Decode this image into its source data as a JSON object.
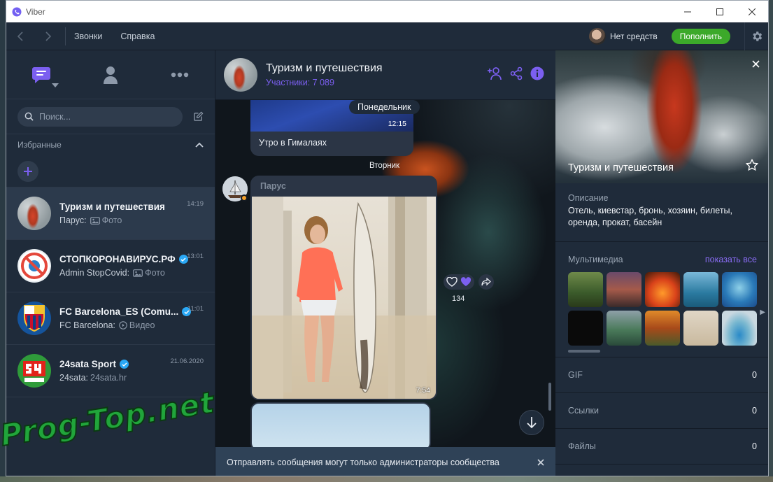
{
  "window": {
    "title": "Viber"
  },
  "topbar": {
    "menu": [
      "Звонки",
      "Справка"
    ],
    "account": "Нет средств",
    "topup": "Пополнить"
  },
  "search": {
    "placeholder": "Поиск..."
  },
  "favorites": {
    "label": "Избранные"
  },
  "chats": [
    {
      "name": "Туризм и путешествия",
      "sender": "Парус:",
      "preview": "Фото",
      "time": "14:19",
      "verified": false
    },
    {
      "name": "СТОПКОРОНАВИРУС.РФ",
      "sender": "Admin StopCovid:",
      "preview": "Фото",
      "time": "13:01",
      "verified": true
    },
    {
      "name": "FC Barcelona_ES (Comu...",
      "sender": "FC Barcelona:",
      "preview": "Видео",
      "time": "11:01",
      "verified": true
    },
    {
      "name": "24sata Sport",
      "sender": "24sata:",
      "preview": "24sata.hr",
      "time": "21.06.2020",
      "verified": true
    }
  ],
  "conversation": {
    "title": "Туризм и путешествия",
    "members": "Участники: 7 089",
    "messages": {
      "m1_time": "12:15",
      "m1_caption": "Утро в Гималаях",
      "day1": "Понедельник",
      "day2": "Вторник",
      "m2_sender": "Парус",
      "m2_time": "7:54",
      "reaction_count": "134"
    },
    "admin_notice": "Отправлять сообщения могут только администраторы сообщества"
  },
  "info": {
    "name": "Туризм и путешествия",
    "description_label": "Описание",
    "description": "Отель, киевстар, бронь, хозяин, билеты, оренда, прокат, басейн",
    "media_label": "Мультимедиа",
    "media_all": "показать все",
    "rows": [
      {
        "label": "GIF",
        "value": "0"
      },
      {
        "label": "Ссылки",
        "value": "0"
      },
      {
        "label": "Файлы",
        "value": "0"
      }
    ]
  },
  "watermark": "Prog-Top.net",
  "colors": {
    "accent": "#7b5ff0",
    "topup": "#3ca92a",
    "panel": "#1f2b3a",
    "verified": "#2aa8f5"
  }
}
